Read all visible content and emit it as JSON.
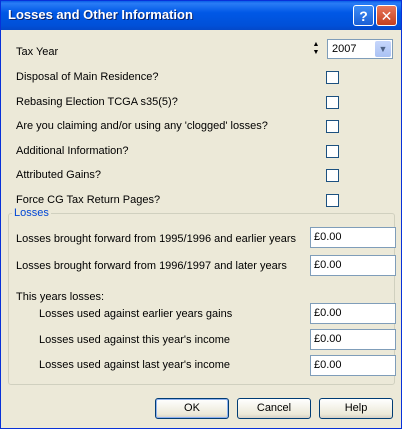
{
  "window": {
    "title": "Losses and Other Information",
    "help_glyph": "?",
    "close_glyph": "✕"
  },
  "tax_year": {
    "label": "Tax Year",
    "value": "2007"
  },
  "options": [
    {
      "label": "Disposal of Main Residence?",
      "checked": false
    },
    {
      "label": "Rebasing Election TCGA s35(5)?",
      "checked": false
    },
    {
      "label": "Are you claiming and/or using any 'clogged' losses?",
      "checked": false
    },
    {
      "label": "Additional Information?",
      "checked": false
    },
    {
      "label": "Attributed Gains?",
      "checked": false
    },
    {
      "label": "Force CG Tax Return Pages?",
      "checked": false
    }
  ],
  "losses": {
    "caption": "Losses",
    "bf_1995": {
      "label": "Losses brought forward from 1995/1996 and earlier years",
      "value": "£0.00"
    },
    "bf_1996": {
      "label": "Losses brought forward from 1996/1997 and later years",
      "value": "£0.00"
    },
    "this_years_label": "This years losses:",
    "used_gains": {
      "label": "Losses used against earlier years gains",
      "value": "£0.00"
    },
    "used_this_income": {
      "label": "Losses used against this year's income",
      "value": "£0.00"
    },
    "used_last_income": {
      "label": "Losses used against last year's income",
      "value": "£0.00"
    }
  },
  "buttons": {
    "ok": "OK",
    "cancel": "Cancel",
    "help": "Help"
  }
}
